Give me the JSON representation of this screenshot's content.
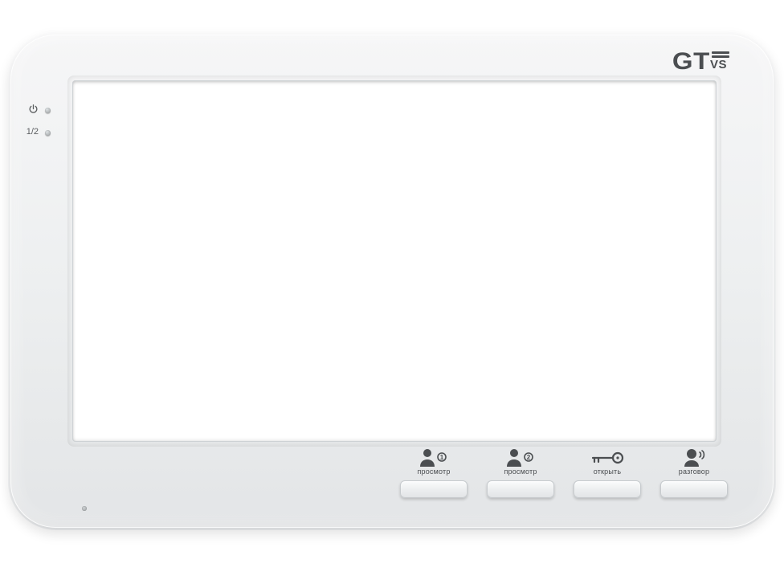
{
  "brand": {
    "left": "GT",
    "right": "VS"
  },
  "indicators": {
    "select_label": "1/2"
  },
  "buttons": [
    {
      "id": "view1",
      "label": "просмотр",
      "icon": "person1"
    },
    {
      "id": "view2",
      "label": "просмотр",
      "icon": "person2"
    },
    {
      "id": "open",
      "label": "открыть",
      "icon": "key"
    },
    {
      "id": "talk",
      "label": "разговор",
      "icon": "talk"
    }
  ]
}
